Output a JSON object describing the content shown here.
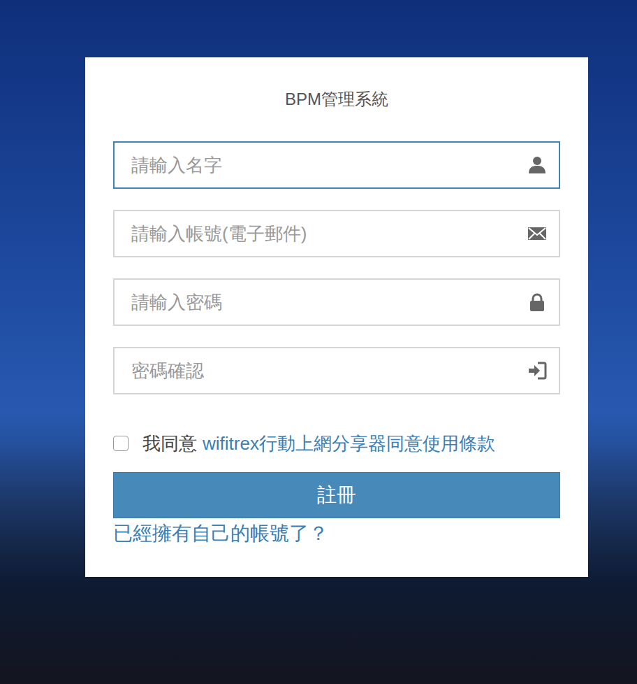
{
  "form": {
    "title": "BPM管理系統",
    "fields": [
      {
        "placeholder": "請輸入名字",
        "focused": true
      },
      {
        "placeholder": "請輸入帳號(電子郵件)",
        "focused": false
      },
      {
        "placeholder": "請輸入密碼",
        "focused": false
      },
      {
        "placeholder": "密碼確認",
        "focused": false
      }
    ],
    "agreement": {
      "label": "我同意",
      "link": "wifitrex行動上網分享器同意使用條款",
      "checked": false
    },
    "submit": "註冊",
    "login_link": "已經擁有自己的帳號了？"
  }
}
